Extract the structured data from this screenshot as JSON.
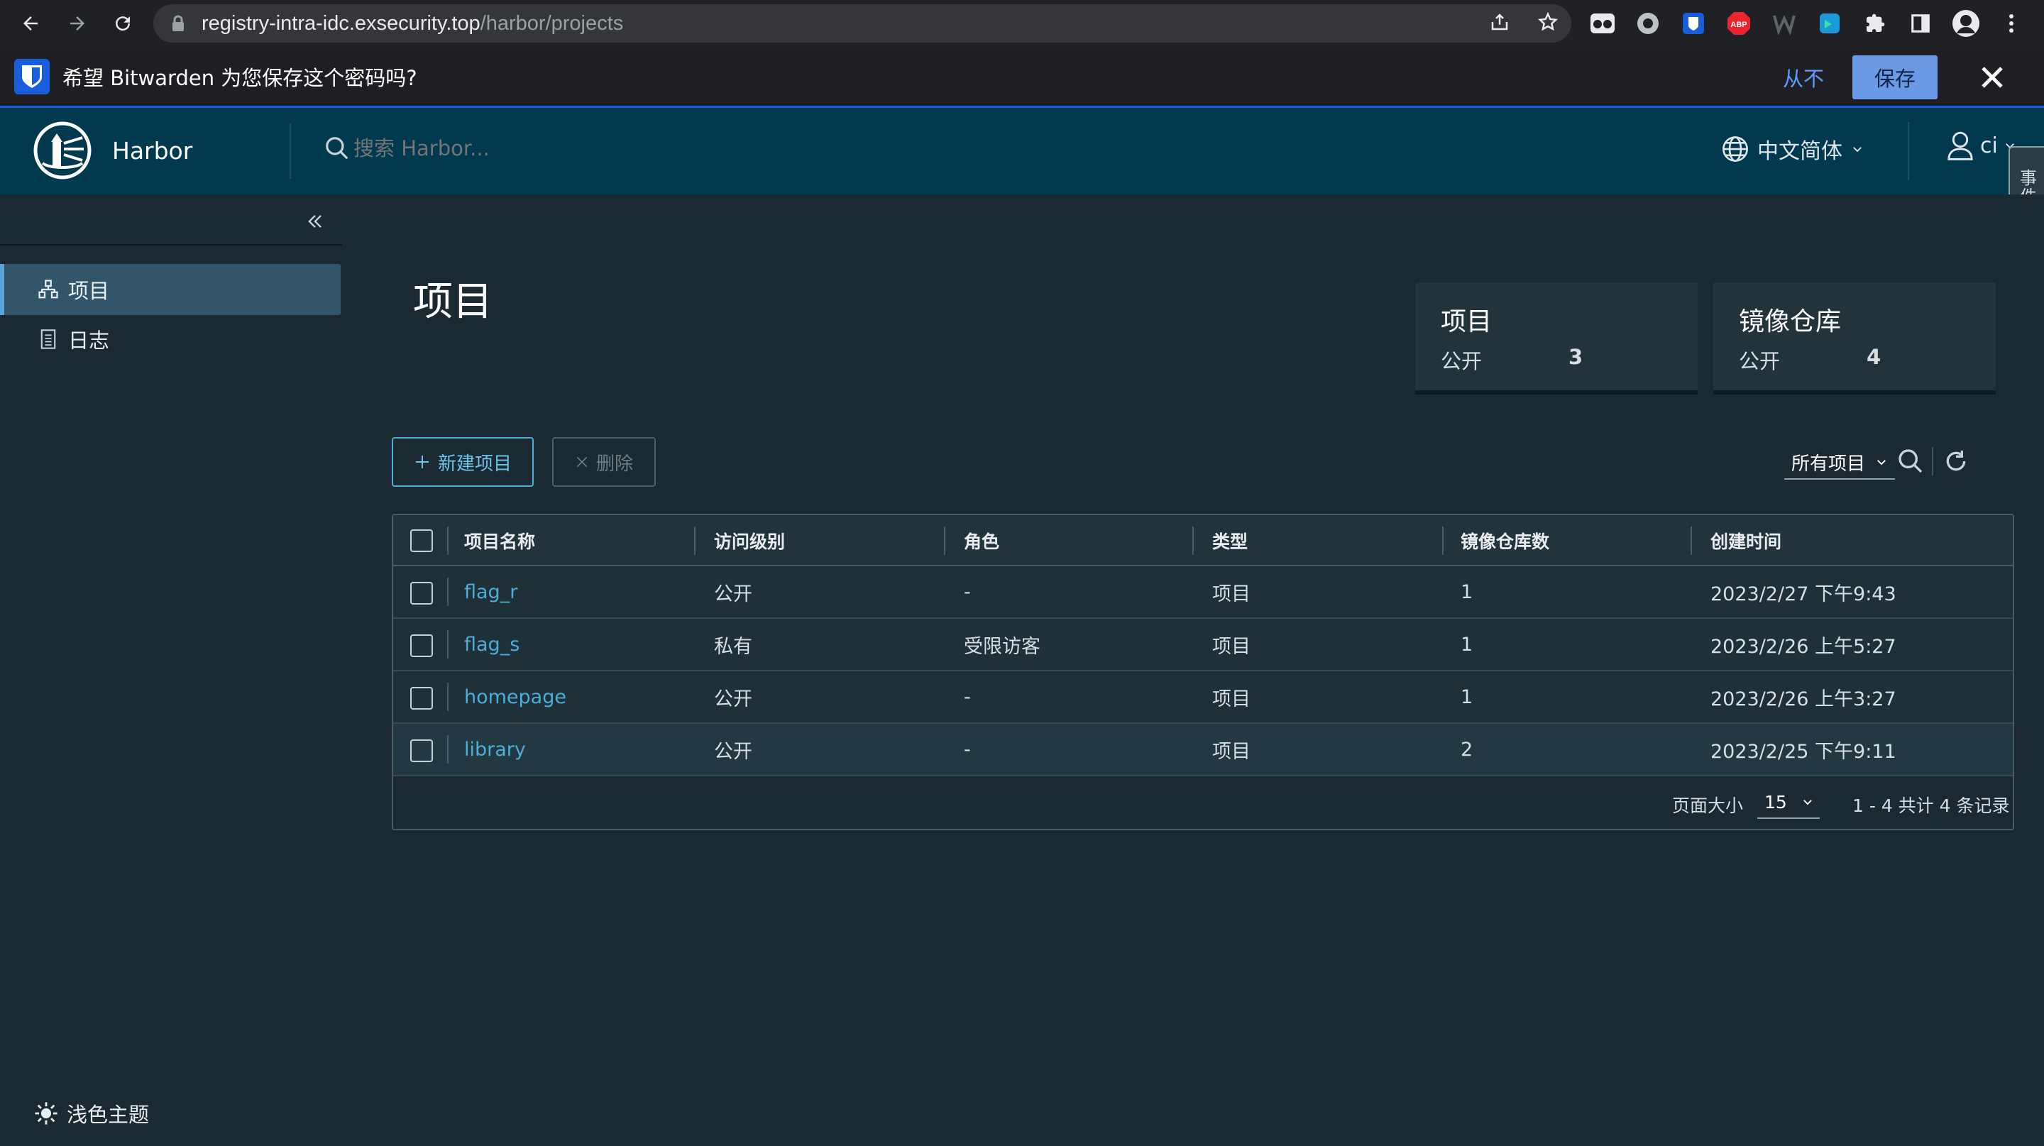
{
  "browser": {
    "url_host": "registry-intra-idc.exsecurity.top",
    "url_path": "/harbor/projects"
  },
  "bitwarden": {
    "prompt": "希望 Bitwarden 为您保存这个密码吗?",
    "never_label": "从不",
    "save_label": "保存"
  },
  "header": {
    "brand": "Harbor",
    "search_placeholder": "搜索 Harbor...",
    "language": "中文简体",
    "user": "ci"
  },
  "side_tab": {
    "label": "事件日志"
  },
  "sidebar": {
    "items": [
      {
        "label": "项目",
        "active": true
      },
      {
        "label": "日志",
        "active": false
      }
    ],
    "theme_toggle": "浅色主题"
  },
  "main": {
    "title": "项目",
    "stats": [
      {
        "title": "项目",
        "label": "公开",
        "value": "3"
      },
      {
        "title": "镜像仓库",
        "label": "公开",
        "value": "4"
      }
    ],
    "new_button": "新建项目",
    "delete_button": "删除",
    "filter": "所有项目"
  },
  "table": {
    "columns": [
      "项目名称",
      "访问级别",
      "角色",
      "类型",
      "镜像仓库数",
      "创建时间"
    ],
    "rows": [
      {
        "name": "flag_r",
        "access": "公开",
        "role": "-",
        "type": "项目",
        "repos": "1",
        "created": "2023/2/27 下午9:43"
      },
      {
        "name": "flag_s",
        "access": "私有",
        "role": "受限访客",
        "type": "项目",
        "repos": "1",
        "created": "2023/2/26 上午5:27"
      },
      {
        "name": "homepage",
        "access": "公开",
        "role": "-",
        "type": "项目",
        "repos": "1",
        "created": "2023/2/26 上午3:27"
      },
      {
        "name": "library",
        "access": "公开",
        "role": "-",
        "type": "项目",
        "repos": "2",
        "created": "2023/2/25 下午9:11"
      }
    ],
    "page_size_label": "页面大小",
    "page_size": "15",
    "page_info": "1 - 4 共计 4 条记录"
  }
}
